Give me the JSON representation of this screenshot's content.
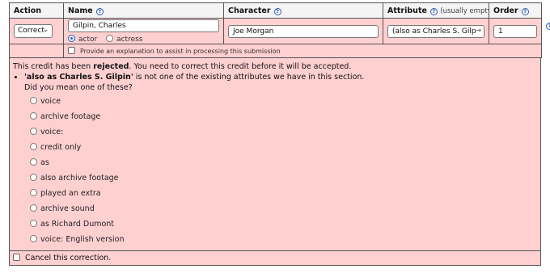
{
  "headers": {
    "action": "Action",
    "name": "Name",
    "character": "Character",
    "attribute": "Attribute",
    "attribute_hint": "(usually empty)",
    "order": "Order"
  },
  "row": {
    "action_value": "Correct",
    "name_value": "Gilpin, Charles",
    "role_actor": "actor",
    "role_actress": "actress",
    "character_value": "Joe Morgan",
    "attribute_value": "(also as Charles S. Gilp",
    "order_value": "1",
    "explanation_label": "Provide an explanation to assist in processing this submission"
  },
  "message": {
    "line_prefix": "This credit has been ",
    "line_bold": "rejected",
    "line_suffix": ". You need to correct this credit before it will be accepted.",
    "bullet_bold": "'also as Charles S. Gilpin'",
    "bullet_rest": " is not one of the existing attributes we have in this section.",
    "question": "Did you mean one of these?"
  },
  "options": [
    "voice",
    "archive footage",
    "voice:",
    "credit only",
    "as",
    "also archive footage",
    "played an extra",
    "archive sound",
    "as Richard Dumont",
    "voice: English version"
  ],
  "cancel_label": "Cancel this correction.",
  "colors": {
    "pink": "#ffd0d0",
    "help_blue": "#2f5fb8"
  }
}
